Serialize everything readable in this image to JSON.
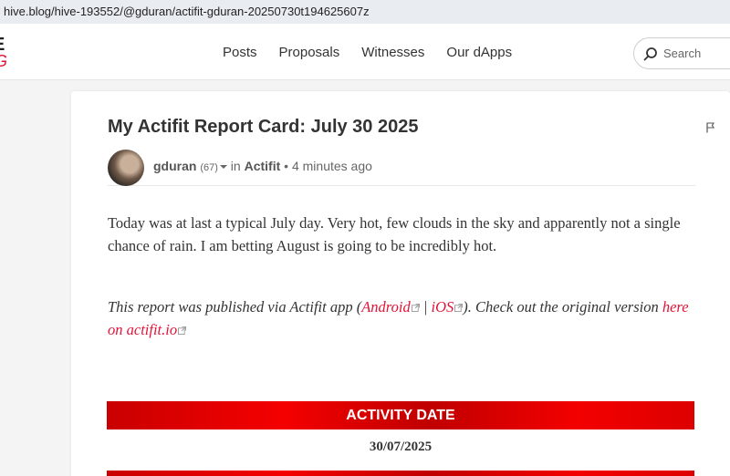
{
  "browser": {
    "url": "hive.blog/hive-193552/@gduran/actifit-gduran-20250730t194625607z"
  },
  "logo": {
    "line1": "E",
    "line2": "G"
  },
  "nav": {
    "links": [
      {
        "label": "Posts"
      },
      {
        "label": "Proposals"
      },
      {
        "label": "Witnesses"
      },
      {
        "label": "Our dApps"
      }
    ],
    "search_placeholder": "Search"
  },
  "post": {
    "title": "My Actifit Report Card: July 30 2025",
    "author": "gduran",
    "reputation": "(67)",
    "in_label": "in",
    "community": "Actifit",
    "bullet": "•",
    "time_ago": "4 minutes ago",
    "body_paragraph": "Today was at last a typical July day. Very hot, few clouds in the sky and apparently not a single chance of rain. I am betting August is going to be incredibly hot.",
    "report_prefix": "This report was published via Actifit app (",
    "android_link": "Android",
    "separator": " | ",
    "ios_link": "iOS",
    "report_middle": "). Check out the original version ",
    "actifit_link": "here on actifit.io",
    "activity_date_heading": "ACTIVITY DATE",
    "activity_date": "30/07/2025"
  },
  "colors": {
    "brand_red": "#e31337",
    "banner_red": "#e60000"
  }
}
